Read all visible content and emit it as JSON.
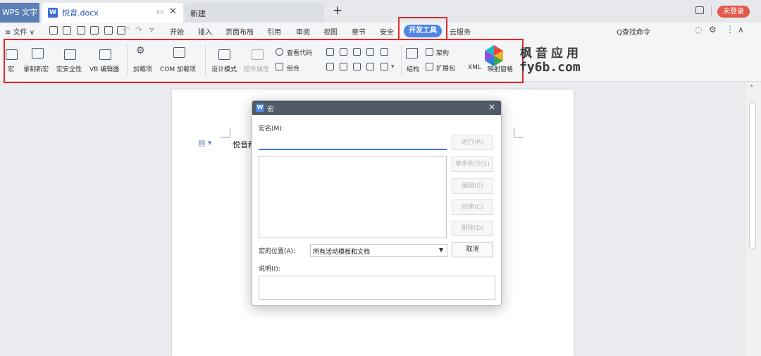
{
  "titlebar": {
    "app_tab": "WPS 文字",
    "doc_tab": "悦音.docx",
    "new_tab": "新建",
    "login": "未登录"
  },
  "menubar": {
    "file": "≡ 文件 ∨",
    "tabs": [
      "开始",
      "插入",
      "页面布局",
      "引用",
      "审阅",
      "视图",
      "章节",
      "安全"
    ],
    "dev_tab": "开发工具",
    "cloud": "云服务",
    "search": "Q查找命令"
  },
  "ribbon": {
    "macro": "宏",
    "record_macro": "录制新宏",
    "macro_security": "宏安全性",
    "vb_editor": "VB 编辑器",
    "addins": "加载项",
    "com_addins": "COM 加载项",
    "design_mode": "设计模式",
    "control_props": "控件属性",
    "view_code": "查看代码",
    "group": "组合",
    "structure": "结构",
    "schema": "架构",
    "expansion": "扩展包",
    "xml": "XML",
    "mapping": "映射窗格"
  },
  "watermark": {
    "line1": "枫音应用",
    "line2": "fy6b.com"
  },
  "document": {
    "text": "悦音科"
  },
  "dialog": {
    "title": "宏",
    "name_label": "宏名(M):",
    "name_value": "",
    "buttons": {
      "run": "运行(R)",
      "step": "单步执行(S)",
      "edit": "编辑(E)",
      "create": "创建(C)",
      "delete": "删除(D)",
      "cancel": "取消"
    },
    "location_label": "宏的位置(A):",
    "location_value": "所有活动模板和文档",
    "desc_label": "说明(I):"
  }
}
